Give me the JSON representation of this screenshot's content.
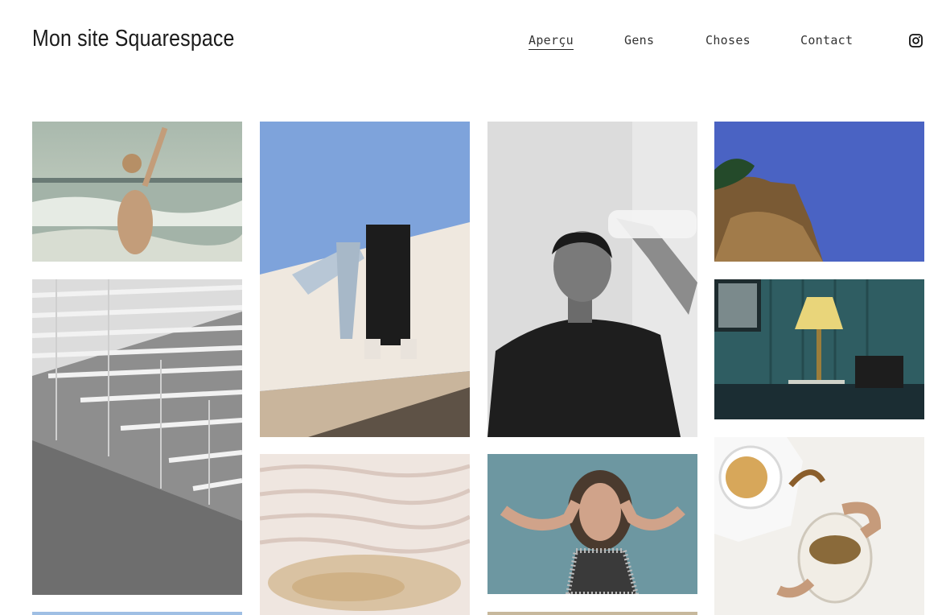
{
  "header": {
    "site_title": "Mon site Squarespace",
    "nav": [
      {
        "label": "Aperçu",
        "active": true
      },
      {
        "label": "Gens",
        "active": false
      },
      {
        "label": "Choses",
        "active": false
      },
      {
        "label": "Contact",
        "active": false
      }
    ],
    "social_icon": "instagram-icon"
  },
  "gallery": {
    "images": [
      "beach-splash-photo",
      "bleachers-photo",
      "people-on-wall-photo",
      "travertine-terraces-photo",
      "water-bottle-portrait-photo",
      "laughing-woman-photo",
      "cliff-sky-photo",
      "bedside-lamp-photo",
      "tea-pour-photo"
    ]
  }
}
